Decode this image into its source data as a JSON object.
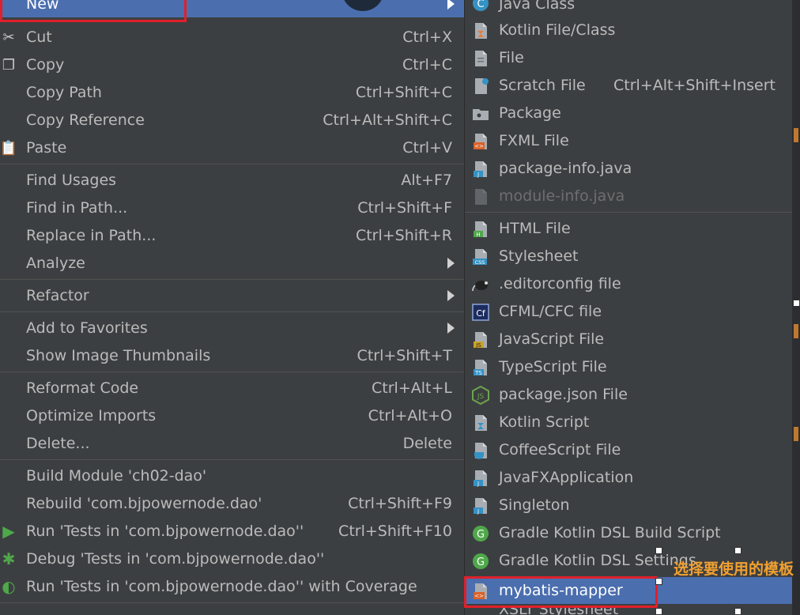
{
  "main_menu": {
    "new": {
      "label": "New"
    },
    "items": [
      {
        "label": "Cut",
        "shortcut": "Ctrl+X"
      },
      {
        "label": "Copy",
        "shortcut": "Ctrl+C"
      },
      {
        "label": "Copy Path",
        "shortcut": "Ctrl+Shift+C"
      },
      {
        "label": "Copy Reference",
        "shortcut": "Ctrl+Alt+Shift+C"
      },
      {
        "label": "Paste",
        "shortcut": "Ctrl+V"
      },
      {
        "label": "Find Usages",
        "shortcut": "Alt+F7"
      },
      {
        "label": "Find in Path...",
        "shortcut": "Ctrl+Shift+F"
      },
      {
        "label": "Replace in Path...",
        "shortcut": "Ctrl+Shift+R"
      },
      {
        "label": "Analyze"
      },
      {
        "label": "Refactor"
      },
      {
        "label": "Add to Favorites"
      },
      {
        "label": "Show Image Thumbnails",
        "shortcut": "Ctrl+Shift+T"
      },
      {
        "label": "Reformat Code",
        "shortcut": "Ctrl+Alt+L"
      },
      {
        "label": "Optimize Imports",
        "shortcut": "Ctrl+Alt+O"
      },
      {
        "label": "Delete...",
        "shortcut": "Delete"
      },
      {
        "label": "Build Module 'ch02-dao'"
      },
      {
        "label": "Rebuild 'com.bjpowernode.dao'",
        "shortcut": "Ctrl+Shift+F9"
      },
      {
        "label": "Run 'Tests in 'com.bjpowernode.dao''",
        "shortcut": "Ctrl+Shift+F10"
      },
      {
        "label": "Debug 'Tests in 'com.bjpowernode.dao''"
      },
      {
        "label": "Run 'Tests in 'com.bjpowernode.dao'' with Coverage"
      }
    ]
  },
  "submenu": {
    "items": [
      {
        "label": "Java Class"
      },
      {
        "label": "Kotlin File/Class"
      },
      {
        "label": "File"
      },
      {
        "label": "Scratch File",
        "shortcut": "Ctrl+Alt+Shift+Insert"
      },
      {
        "label": "Package"
      },
      {
        "label": "FXML File"
      },
      {
        "label": "package-info.java"
      },
      {
        "label": "module-info.java"
      },
      {
        "label": "HTML File"
      },
      {
        "label": "Stylesheet"
      },
      {
        "label": ".editorconfig file"
      },
      {
        "label": "CFML/CFC file"
      },
      {
        "label": "JavaScript File"
      },
      {
        "label": "TypeScript File"
      },
      {
        "label": "package.json File"
      },
      {
        "label": "Kotlin Script"
      },
      {
        "label": "CoffeeScript File"
      },
      {
        "label": "JavaFXApplication"
      },
      {
        "label": "Singleton"
      },
      {
        "label": "Gradle Kotlin DSL Build Script"
      },
      {
        "label": "Gradle Kotlin DSL Settings"
      },
      {
        "label": "mybatis-mapper"
      },
      {
        "label": "XSLT Stylesheet"
      }
    ]
  },
  "annotation": {
    "text": "选择要使用的模板"
  },
  "colors": {
    "highlight": "#4b6eaf",
    "menu_bg": "#3c3f41",
    "annotation_box": "#e0202a",
    "annotation_text": "#f0a030"
  }
}
